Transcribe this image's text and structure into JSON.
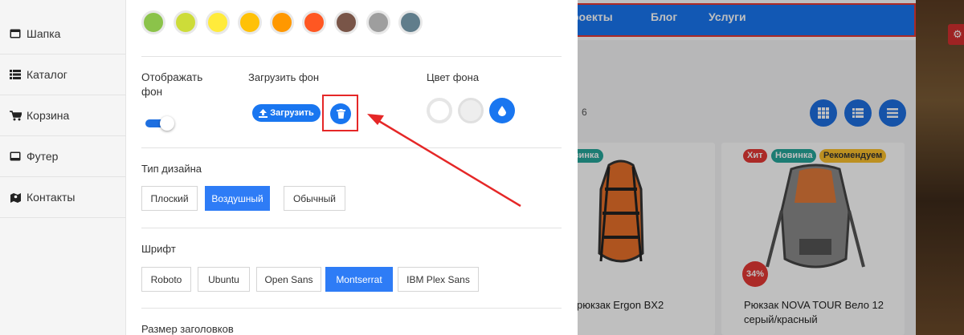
{
  "menu": {
    "items": [
      {
        "label": "Шапка",
        "icon": "window-icon"
      },
      {
        "label": "Каталог",
        "icon": "list-icon"
      },
      {
        "label": "Корзина",
        "icon": "cart-icon"
      },
      {
        "label": "Футер",
        "icon": "footer-icon"
      },
      {
        "label": "Контакты",
        "icon": "contacts-icon"
      }
    ]
  },
  "panel": {
    "swatches": [
      "#8bc34a",
      "#cddc39",
      "#ffeb3b",
      "#ffc107",
      "#ff9800",
      "#ff5722",
      "#795548",
      "#9e9e9e",
      "#607d8b"
    ],
    "show_bg_label": "Отображать фон",
    "upload_bg_label": "Загрузить фон",
    "bg_color_label": "Цвет фона",
    "upload_button": "Загрузить",
    "design_type_label": "Тип дизайна",
    "design_types": [
      "Плоский",
      "Воздушный",
      "Обычный"
    ],
    "design_active": "Воздушный",
    "font_label": "Шрифт",
    "fonts": [
      "Roboto",
      "Ubuntu",
      "Open Sans",
      "Montserrat",
      "IBM Plex Sans"
    ],
    "font_active": "Montserrat",
    "heading_size_label": "Размер заголовков",
    "show_bg_enabled": true
  },
  "shop": {
    "nav": [
      "роекты",
      "Блог",
      "Услуги"
    ],
    "count_text": "6",
    "products": [
      {
        "title": "рюкзак Ergon BX2",
        "badges": [
          "овинка"
        ]
      },
      {
        "title": "Рюкзак NOVA TOUR Вело 12 серый/красный",
        "badges": [
          "Хит",
          "Новинка",
          "Рекомендуем"
        ],
        "discount": "34%"
      }
    ]
  },
  "colors": {
    "accent": "#1976f0",
    "highlight": "#e52727"
  }
}
